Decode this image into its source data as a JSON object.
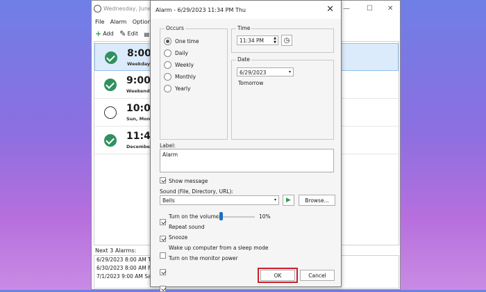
{
  "main_window": {
    "title": "Wednesday, June 2",
    "menu": [
      "File",
      "Alarm",
      "Options"
    ],
    "toolbar": {
      "add": "Add",
      "edit": "Edit"
    },
    "alarms": [
      {
        "time": "8:00 A",
        "sub": "Weekdays",
        "enabled": true,
        "selected": true
      },
      {
        "time": "9:00 A",
        "sub": "Weekends",
        "enabled": true,
        "selected": false
      },
      {
        "time": "10:00",
        "sub": "Sun, Mon,",
        "enabled": false,
        "selected": false
      },
      {
        "time": "11:40",
        "sub": "December",
        "enabled": true,
        "selected": false
      }
    ],
    "next_label": "Next 3 Alarms:",
    "next_alarms": [
      "6/29/2023 8:00 AM Thu",
      "6/30/2023 8:00 AM Fri",
      "7/1/2023 9:00 AM Sat"
    ]
  },
  "dialog": {
    "title": "Alarm - 6/29/2023 11:34 PM Thu",
    "occurs_label": "Occurs",
    "occurs_options": [
      "One time",
      "Daily",
      "Weekly",
      "Monthly",
      "Yearly"
    ],
    "occurs_selected": 0,
    "time_label": "Time",
    "time_value": "11:34 PM",
    "date_label": "Date",
    "date_value": "6/29/2023",
    "date_hint": "Tomorrow",
    "label_label": "Label:",
    "label_value": "Alarm",
    "show_message": "Show message",
    "sound_label": "Sound (File, Directory, URL):",
    "sound_value": "Bells",
    "browse": "Browse...",
    "volume_label": "Turn on the volume",
    "volume_level": 0.1,
    "volume_text": "10%",
    "repeat_sound": "Repeat sound",
    "snooze": "Snooze",
    "wake_up": "Wake up computer from a sleep mode",
    "monitor_power": "Turn on the monitor power",
    "ok": "OK",
    "cancel": "Cancel",
    "highlight_color": "#c8202b",
    "play_color": "#2e9e4f"
  }
}
